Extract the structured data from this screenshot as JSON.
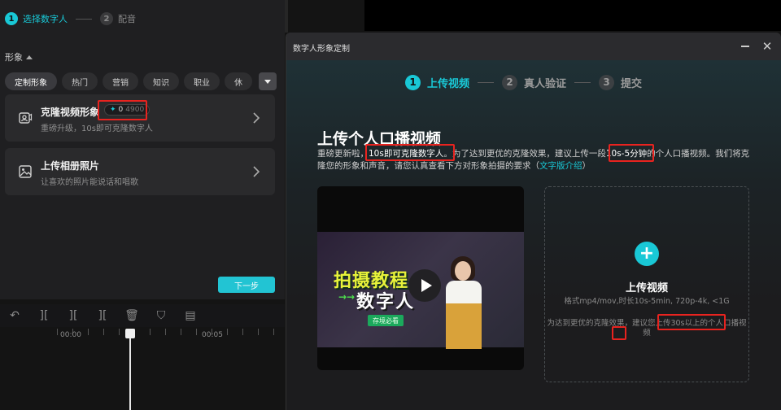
{
  "left_stepper": {
    "step1_num": "1",
    "step1_label": "选择数字人",
    "step2_num": "2",
    "step2_label": "配音"
  },
  "section_title": "形象",
  "chips": [
    "定制形象",
    "热门",
    "营销",
    "知识",
    "职业",
    "休"
  ],
  "cards": [
    {
      "title": "克隆视频形象",
      "desc": "重磅升级，10s即可克隆数字人",
      "icon": "clone-avatar-icon",
      "credit_current": "0",
      "credit_total": "4900"
    },
    {
      "title": "上传相册照片",
      "desc": "让喜欢的照片能说话和唱歌",
      "icon": "photo-upload-icon"
    }
  ],
  "next_button": "下一步",
  "timeline": {
    "tools": [
      "undo-icon",
      "split-icon",
      "split-left-icon",
      "split-right-icon",
      "delete-icon",
      "marker-icon",
      "caption-icon"
    ],
    "time_start": "00:00",
    "time_mark": "00:05"
  },
  "dialog": {
    "title": "数字人形象定制",
    "steps": [
      {
        "num": "1",
        "label": "上传视频"
      },
      {
        "num": "2",
        "label": "真人验证"
      },
      {
        "num": "3",
        "label": "提交"
      }
    ],
    "heading": "上传个人口播视频",
    "desc_part1": "重磅更新啦，",
    "desc_highlight1": "10s即可克隆数字人",
    "desc_part2": "。为了达到更优的克隆效果，建议上传一段",
    "desc_highlight2": "10s-5分钟",
    "desc_part3": "的个人口播视频。我们将克隆您的形象和声音，请您认真查看下方对形象拍摄的要求（",
    "desc_link": "文字版介绍",
    "desc_part4": "）",
    "video": {
      "title_line1": "拍摄教程",
      "title_line2": "数字人",
      "arrows": "→→",
      "tag": "存境必看"
    },
    "upload": {
      "title": "上传视频",
      "format": "格式mp4/mov,时长10s-5min, 720p-4k, <1G",
      "tip": "为达到更优的克隆效果，建议您上传30s以上的个人口播视频"
    }
  },
  "colors": {
    "accent": "#19c8d6",
    "highlight_box": "#e8231f"
  }
}
